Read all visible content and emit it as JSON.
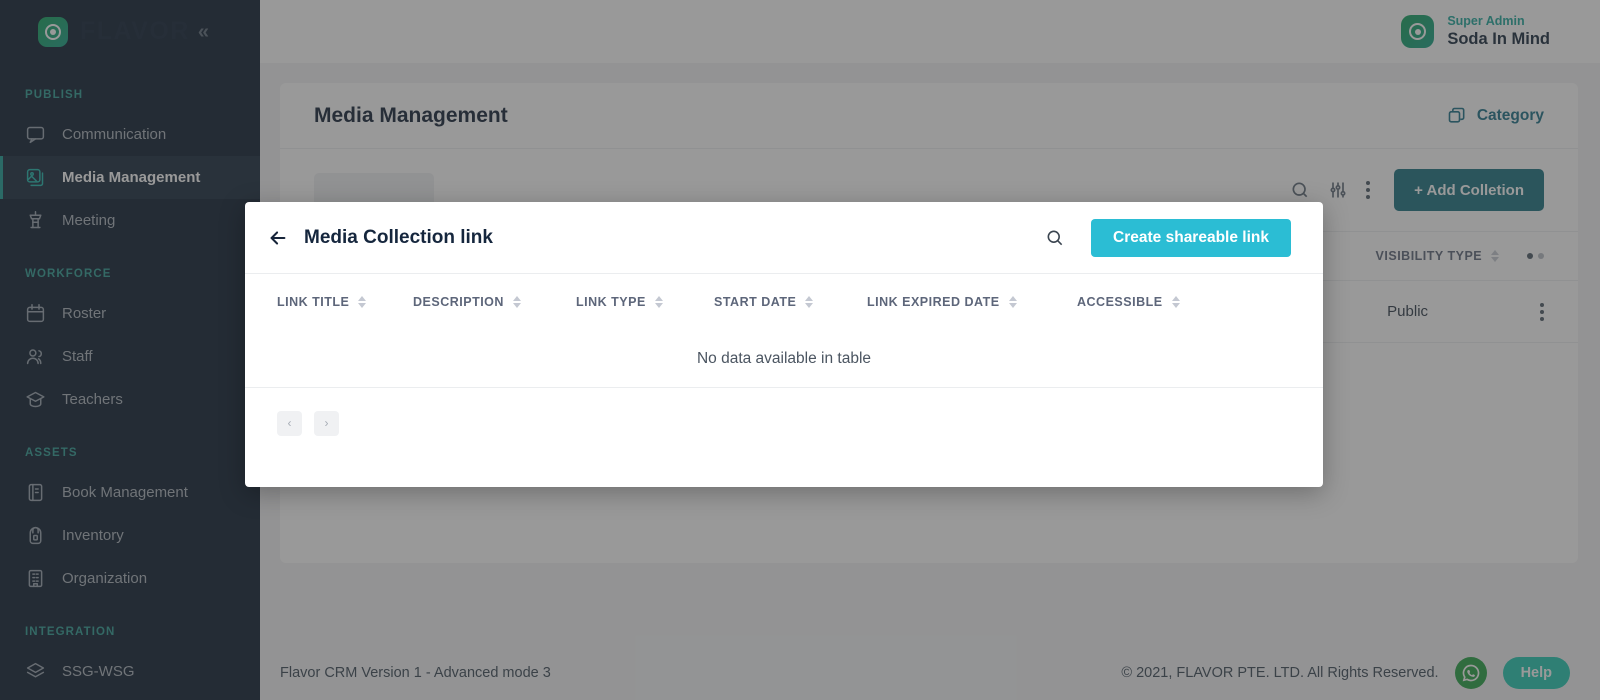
{
  "brand": {
    "name": "FLAVOR",
    "collapse_icon": "double-chevron-left-icon"
  },
  "topbar": {
    "user_role": "Super Admin",
    "user_name": "Soda In Mind"
  },
  "sidebar": {
    "sections": [
      {
        "label": "PUBLISH",
        "items": [
          {
            "label": "Communication",
            "icon": "chat-bubble-icon",
            "active": false
          },
          {
            "label": "Media Management",
            "icon": "image-stack-icon",
            "active": true
          },
          {
            "label": "Meeting",
            "icon": "podium-icon",
            "active": false
          }
        ]
      },
      {
        "label": "WORKFORCE",
        "items": [
          {
            "label": "Roster",
            "icon": "calendar-icon",
            "active": false
          },
          {
            "label": "Staff",
            "icon": "users-icon",
            "active": false
          },
          {
            "label": "Teachers",
            "icon": "graduation-cap-icon",
            "active": false
          }
        ]
      },
      {
        "label": "ASSETS",
        "items": [
          {
            "label": "Book Management",
            "icon": "book-icon",
            "active": false
          },
          {
            "label": "Inventory",
            "icon": "backpack-icon",
            "active": false
          },
          {
            "label": "Organization",
            "icon": "building-icon",
            "active": false
          }
        ]
      },
      {
        "label": "INTEGRATION",
        "items": [
          {
            "label": "SSG-WSG",
            "icon": "layers-icon",
            "active": false
          }
        ]
      }
    ]
  },
  "page": {
    "title": "Media Management",
    "category_button": "Category",
    "add_button": "+ Add Colletion",
    "table": {
      "columns": [
        "VISIBILITY TYPE"
      ],
      "rows": [
        {
          "visibility_type": "Public"
        }
      ]
    }
  },
  "modal": {
    "title": "Media Collection link",
    "back_icon": "arrow-left-icon",
    "search_icon": "search-icon",
    "create_button": "Create shareable link",
    "columns": [
      "LINK TITLE",
      "DESCRIPTION",
      "LINK TYPE",
      "START DATE",
      "LINK EXPIRED DATE",
      "ACCESSIBLE"
    ],
    "empty_message": "No data available in table",
    "pagination": {
      "prev": "‹",
      "next": "›"
    }
  },
  "footer": {
    "version": "Flavor CRM Version 1 - Advanced mode 3",
    "copyright": "© 2021, FLAVOR PTE. LTD. All Rights Reserved.",
    "help_button": "Help",
    "whatsapp_icon": "whatsapp-icon"
  },
  "colors": {
    "sidebar_bg": "#0b1c2e",
    "accent_teal": "#1ea79c",
    "modal_primary": "#2bbdd4",
    "add_button": "#1a7180",
    "category_link": "#1b6f86",
    "help_button": "#22c9b1"
  }
}
